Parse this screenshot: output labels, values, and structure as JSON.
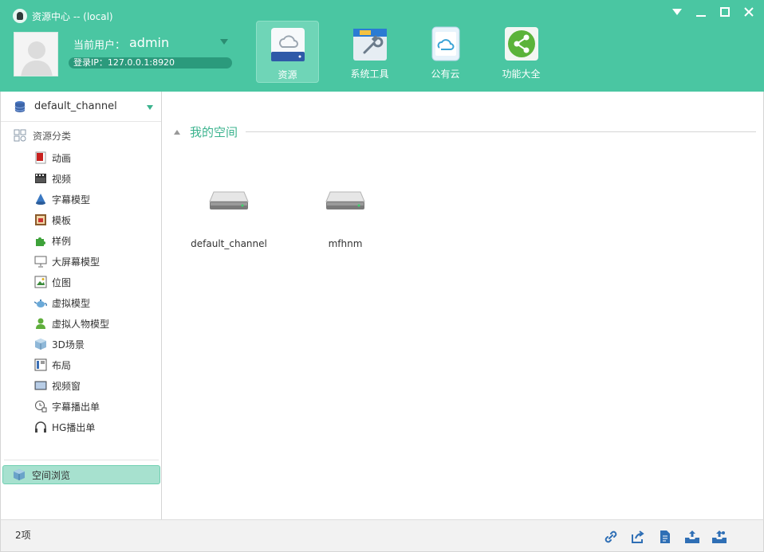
{
  "window": {
    "title": "资源中心 -- (local)"
  },
  "user": {
    "label": "当前用户：",
    "name": "admin",
    "login_ip": "登录IP：127.0.0.1:8920"
  },
  "nav": {
    "items": [
      {
        "label": "资源",
        "icon": "cloud-drive-icon",
        "active": true
      },
      {
        "label": "系统工具",
        "icon": "wrench-tools-icon",
        "active": false
      },
      {
        "label": "公有云",
        "icon": "cloud-phone-icon",
        "active": false
      },
      {
        "label": "功能大全",
        "icon": "share-icon",
        "active": false
      }
    ]
  },
  "sidebar": {
    "channel": "default_channel",
    "category_header": "资源分类",
    "categories": [
      {
        "label": "动画",
        "icon": "animation-icon"
      },
      {
        "label": "视频",
        "icon": "film-icon"
      },
      {
        "label": "字幕模型",
        "icon": "cone-icon"
      },
      {
        "label": "模板",
        "icon": "template-icon"
      },
      {
        "label": "样例",
        "icon": "puzzle-icon"
      },
      {
        "label": "大屏幕模型",
        "icon": "monitor-icon"
      },
      {
        "label": "位图",
        "icon": "bitmap-icon"
      },
      {
        "label": "虚拟模型",
        "icon": "teapot-icon"
      },
      {
        "label": "虚拟人物模型",
        "icon": "person-icon"
      },
      {
        "label": "3D场景",
        "icon": "cube-icon"
      },
      {
        "label": "布局",
        "icon": "layout-icon"
      },
      {
        "label": "视频窗",
        "icon": "video-window-icon"
      },
      {
        "label": "字幕播出单",
        "icon": "clock-list-icon"
      },
      {
        "label": "HG播出单",
        "icon": "headphones-icon"
      }
    ],
    "space_browse": "空间浏览"
  },
  "main": {
    "section_title": "我的空间",
    "drives": [
      {
        "label": "default_channel"
      },
      {
        "label": "mfhnm"
      }
    ]
  },
  "status": {
    "count": "2项"
  },
  "colors": {
    "header": "#4ac6a2",
    "accent": "#3bb38e",
    "selected": "#a7e1cf"
  }
}
